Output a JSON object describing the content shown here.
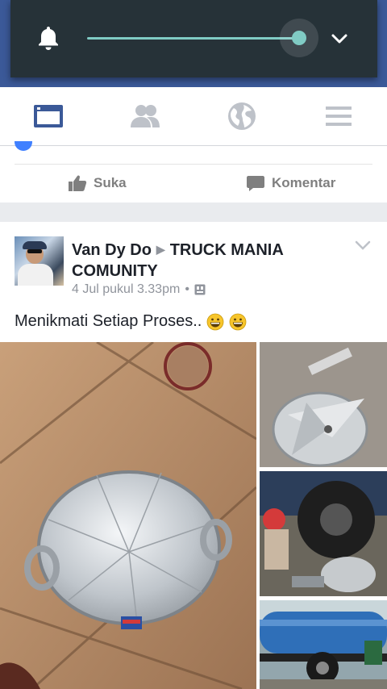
{
  "volume_panel": {
    "icons": {
      "bell": "bell-icon",
      "expand": "chevron-down-icon"
    },
    "level": 1.0,
    "accent_color": "#80cbc4"
  },
  "tabs": [
    {
      "name": "news-feed",
      "icon": "news-feed-icon",
      "active": true
    },
    {
      "name": "friends",
      "icon": "friends-icon",
      "active": false
    },
    {
      "name": "notifications",
      "icon": "globe-icon",
      "active": false
    },
    {
      "name": "menu",
      "icon": "menu-icon",
      "active": false
    }
  ],
  "previous_post": {
    "like_label": "Suka",
    "comment_label": "Komentar"
  },
  "post": {
    "author": "Van Dy Do",
    "group": "TRUCK MANIA COMUNITY",
    "timestamp": "4 Jul pukul 3.33pm",
    "separator": "•",
    "caption": "Menikmati Setiap Proses..",
    "emoji": [
      "grinning-face-emoji",
      "grinning-face-emoji"
    ],
    "photos": [
      "aluminium-cone-photo",
      "cone-assembly-photo",
      "mechanic-working-photo",
      "tanker-truck-photo"
    ]
  },
  "colors": {
    "header_blue": "#3b5998",
    "active_tab": "#3b5998",
    "inactive_tab": "#bec2c9"
  }
}
